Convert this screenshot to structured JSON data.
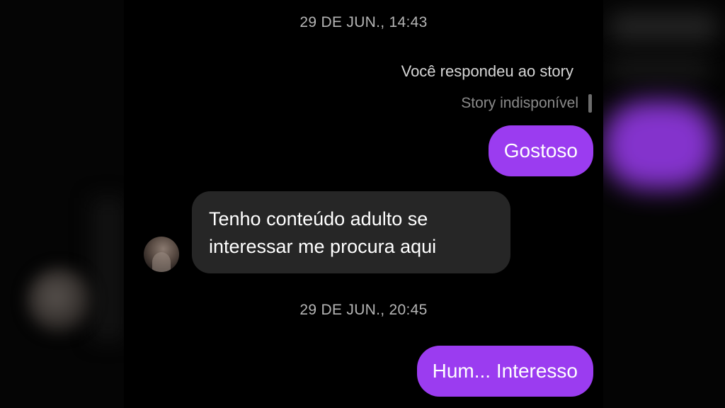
{
  "conversation": {
    "timestamp_1": "29 DE JUN., 14:43",
    "reply_notice": "Você respondeu ao story",
    "story_status": "Story indisponível",
    "messages": [
      {
        "direction": "outgoing",
        "text": "Gostoso"
      },
      {
        "direction": "incoming",
        "lines": [
          "Tenho conteúdo adulto se",
          "interessar me procura aqui"
        ]
      },
      {
        "direction": "outgoing",
        "text": "Hum... Interesso"
      }
    ],
    "timestamp_2": "29 DE JUN., 20:45"
  },
  "colors": {
    "background": "#000000",
    "outgoing_bubble": "#9b3cf0",
    "incoming_bubble": "#262626",
    "timestamp_text": "#b5b5b5"
  },
  "icons": {
    "contact_avatar": "avatar-icon"
  }
}
